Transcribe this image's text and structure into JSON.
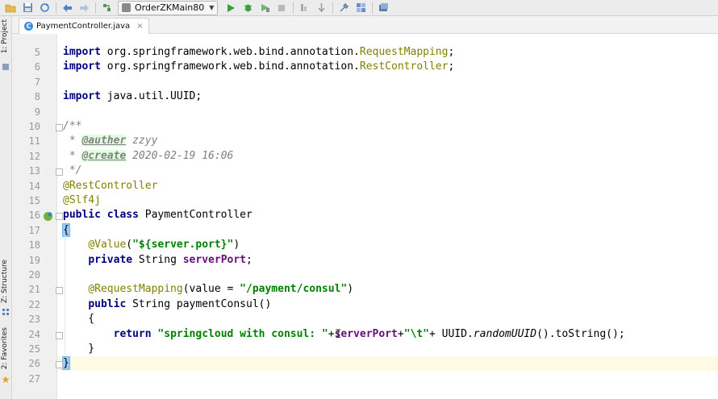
{
  "toolbar": {
    "run_config": "OrderZKMain80",
    "icons": [
      "folder-icon",
      "save-icon",
      "sync-icon",
      "back-icon",
      "forward-icon",
      "build-icon",
      "run-icon",
      "debug-icon",
      "coverage-icon",
      "stop-icon",
      "ant-icon",
      "vcs-icon",
      "settings-icon",
      "project-structure-icon",
      "sdk-icon"
    ]
  },
  "tool_windows": {
    "project": "1: Project",
    "structure": "Z: Structure",
    "favorites": "2: Favorites"
  },
  "editor_tab": {
    "label": "PaymentController.java",
    "close": "×"
  },
  "colors": {
    "keyword": "#000080",
    "string": "#008000",
    "annotation": "#808000",
    "field": "#660e7a",
    "comment": "#808080",
    "current_line": "#fffae3",
    "brace_highlight": "#99ccff"
  },
  "lines": [
    {
      "no": "5",
      "tokens": [
        [
          "kw",
          "import"
        ],
        [
          "pkg",
          " org.springframework.web.bind.annotation."
        ],
        [
          "ann-cls",
          "RequestMapping"
        ],
        [
          "pkg",
          ";"
        ]
      ]
    },
    {
      "no": "6",
      "tokens": [
        [
          "kw",
          "import"
        ],
        [
          "pkg",
          " org.springframework.web.bind.annotation."
        ],
        [
          "ann-cls",
          "RestController"
        ],
        [
          "pkg",
          ";"
        ]
      ]
    },
    {
      "no": "7",
      "tokens": []
    },
    {
      "no": "8",
      "tokens": [
        [
          "kw",
          "import"
        ],
        [
          "pkg",
          " java.util.UUID;"
        ]
      ]
    },
    {
      "no": "9",
      "tokens": []
    },
    {
      "no": "10",
      "tokens": [
        [
          "cmt",
          "/**"
        ]
      ]
    },
    {
      "no": "11",
      "tokens": [
        [
          "cmt",
          " * "
        ],
        [
          "doctag",
          "@auther"
        ],
        [
          "cmt",
          " "
        ],
        [
          "docval",
          "zzyy"
        ]
      ]
    },
    {
      "no": "12",
      "tokens": [
        [
          "cmt",
          " * "
        ],
        [
          "doctag",
          "@create"
        ],
        [
          "cmt",
          " 2020-02-19 16:06"
        ]
      ]
    },
    {
      "no": "13",
      "tokens": [
        [
          "cmt",
          " */"
        ]
      ]
    },
    {
      "no": "14",
      "tokens": [
        [
          "ann-cls",
          "@RestController"
        ]
      ]
    },
    {
      "no": "15",
      "tokens": [
        [
          "ann-cls",
          "@Slf4j"
        ]
      ]
    },
    {
      "no": "16",
      "tokens": [
        [
          "kw",
          "public class"
        ],
        [
          "pkg",
          " PaymentController"
        ]
      ]
    },
    {
      "no": "17",
      "tokens": [
        [
          "brace-hl",
          "{"
        ]
      ]
    },
    {
      "no": "18",
      "tokens": [
        [
          "pkg",
          "    "
        ],
        [
          "ann-cls",
          "@Value"
        ],
        [
          "pkg",
          "("
        ],
        [
          "str",
          "\"${server.port}\""
        ],
        [
          "pkg",
          ")"
        ]
      ]
    },
    {
      "no": "19",
      "tokens": [
        [
          "pkg",
          "    "
        ],
        [
          "kw",
          "private"
        ],
        [
          "pkg",
          " String "
        ],
        [
          "field",
          "serverPort"
        ],
        [
          "pkg",
          ";"
        ]
      ]
    },
    {
      "no": "20",
      "tokens": []
    },
    {
      "no": "21",
      "tokens": [
        [
          "pkg",
          "    "
        ],
        [
          "ann-cls",
          "@RequestMapping"
        ],
        [
          "pkg",
          "(value = "
        ],
        [
          "str",
          "\"/payment/consul\""
        ],
        [
          "pkg",
          ")"
        ]
      ]
    },
    {
      "no": "22",
      "tokens": [
        [
          "pkg",
          "    "
        ],
        [
          "kw",
          "public"
        ],
        [
          "pkg",
          " String paymentConsul()"
        ]
      ]
    },
    {
      "no": "23",
      "tokens": [
        [
          "pkg",
          "    {"
        ]
      ]
    },
    {
      "no": "24",
      "tokens": [
        [
          "pkg",
          "        "
        ],
        [
          "kw",
          "return"
        ],
        [
          "pkg",
          " "
        ],
        [
          "str",
          "\"springcloud with consul: \""
        ],
        [
          "pkg",
          "+"
        ],
        [
          "field",
          "serverPort"
        ],
        [
          "pkg",
          "+"
        ],
        [
          "str",
          "\"\\t\""
        ],
        [
          "pkg",
          "+ UUID."
        ],
        [
          "ital",
          "randomUUID"
        ],
        [
          "pkg",
          "().toString();"
        ]
      ]
    },
    {
      "no": "25",
      "tokens": [
        [
          "pkg",
          "    }"
        ]
      ]
    },
    {
      "no": "26",
      "tokens": [
        [
          "brace-hl",
          "}"
        ]
      ]
    },
    {
      "no": "27",
      "tokens": []
    }
  ]
}
